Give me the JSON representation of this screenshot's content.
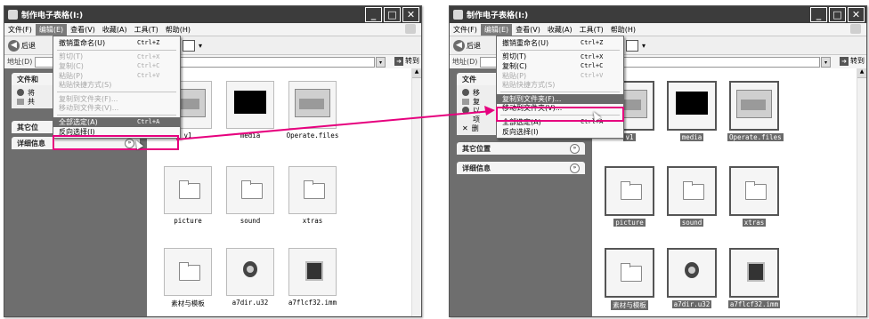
{
  "left": {
    "title": "制作电子表格(I:)",
    "menubar": [
      "文件(F)",
      "编辑(E)",
      "查看(V)",
      "收藏(A)",
      "工具(T)",
      "帮助(H)"
    ],
    "back_label": "后退",
    "address_label": "地址(D)",
    "go_label": "转到",
    "panels": [
      {
        "title": "文件和",
        "tasks": [
          "将",
          "共"
        ]
      },
      {
        "title": "其它位",
        "tasks": []
      },
      {
        "title": "详细信息",
        "tasks": []
      }
    ],
    "files": [
      "v1",
      "media",
      "Operate.files",
      "picture",
      "sound",
      "xtras",
      "素材与模板",
      "a7dir.u32",
      "a7flcf32.imm"
    ],
    "menu": [
      {
        "label": "撤销重命名(U)",
        "shortcut": "Ctrl+Z",
        "disabled": false
      },
      {
        "sep": true
      },
      {
        "label": "剪切(T)",
        "shortcut": "Ctrl+X",
        "disabled": true
      },
      {
        "label": "复制(C)",
        "shortcut": "Ctrl+C",
        "disabled": true
      },
      {
        "label": "粘贴(P)",
        "shortcut": "Ctrl+V",
        "disabled": true
      },
      {
        "label": "粘贴快捷方式(S)",
        "shortcut": "",
        "disabled": true
      },
      {
        "sep": true
      },
      {
        "label": "复制到文件夹(F)...",
        "shortcut": "",
        "disabled": true
      },
      {
        "label": "移动到文件夹(V)...",
        "shortcut": "",
        "disabled": true
      },
      {
        "sep": true
      },
      {
        "label": "全部选定(A)",
        "shortcut": "Ctrl+A",
        "disabled": false,
        "hover": true
      },
      {
        "label": "反向选择(I)",
        "shortcut": "",
        "disabled": false
      }
    ]
  },
  "right": {
    "title": "制作电子表格(I:)",
    "menubar": [
      "文件(F)",
      "编辑(E)",
      "查看(V)",
      "收藏(A)",
      "工具(T)",
      "帮助(H)"
    ],
    "back_label": "后退",
    "address_label": "地址(D)",
    "go_label": "转到",
    "panels": [
      {
        "title": "文件",
        "tasks": [
          "移",
          "复",
          "以",
          "项",
          "删"
        ]
      },
      {
        "title": "其它位置",
        "tasks": []
      },
      {
        "title": "详细信息",
        "tasks": []
      }
    ],
    "files": [
      "v1",
      "media",
      "Operate.files",
      "picture",
      "sound",
      "xtras",
      "素材与模板",
      "a7dir.u32",
      "a7flcf32.imm"
    ],
    "menu": [
      {
        "label": "撤销重命名(U)",
        "shortcut": "Ctrl+Z",
        "disabled": false
      },
      {
        "sep": true
      },
      {
        "label": "剪切(T)",
        "shortcut": "Ctrl+X",
        "disabled": false
      },
      {
        "label": "复制(C)",
        "shortcut": "Ctrl+C",
        "disabled": false
      },
      {
        "label": "粘贴(P)",
        "shortcut": "Ctrl+V",
        "disabled": true
      },
      {
        "label": "粘贴快捷方式(S)",
        "shortcut": "",
        "disabled": true
      },
      {
        "sep": true
      },
      {
        "label": "复制到文件夹(F)...",
        "shortcut": "",
        "disabled": false,
        "hover": true
      },
      {
        "label": "移动到文件夹(V)...",
        "shortcut": "",
        "disabled": false
      },
      {
        "sep": true
      },
      {
        "label": "全部选定(A)",
        "shortcut": "Ctrl+A",
        "disabled": false
      },
      {
        "label": "反向选择(I)",
        "shortcut": "",
        "disabled": false
      }
    ]
  },
  "accent_color": "#e6007e"
}
